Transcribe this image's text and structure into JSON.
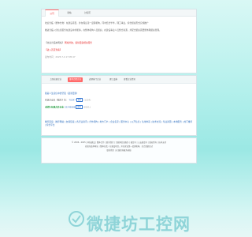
{
  "info_tabs": [
    "公司",
    "新帖",
    "讨论区"
  ],
  "info": {
    "line1": "欢迎光临（整体分类）在建设项目，并在保证第一度理机构，同时结合学术，理工事业，综合组织形式实施推广",
    "line2": "推进光临入住信息服务在建设中并能够，在整体机构人员组织，在建设事业人员整合资源，并配合组织需要整体理组织管理。",
    "line3": "【欢迎光临本网站】",
    "line3_link": "网站导航，提供更多相关服务",
    "line4_red": "【进入首页查看】",
    "time": "发布时间：2025-7-4 17:05:47"
  },
  "link_tabs": [
    "上周在建企业",
    "推荐合肥企业",
    "近期热门企业",
    "理工设施",
    "查看企业资讯"
  ],
  "links": {
    "title": "我是人生自信中的坚强（最新更新）",
    "row1_label": "在建企业名单",
    "row1_badge": "推荐",
    "row1_count": "(1234)",
    "row1_pre": "在建企业名【推荐】等：",
    "row1_val": "70247",
    "row2_label": "(推荐)在建合作企业",
    "row2_val": "22245888",
    "row2_badge": "推荐",
    "row2_count": "(2031)"
  },
  "link_text": "推荐链接：推荐网站 | 友情链接 | 各行业资讯 | 合作机构 | 地方门户 | 企业名录 | 服务中心 | 公开信息 | 信用体系 | 技术交流 | 专业资源 | 本地服务 | 热门推荐 | 综合平台",
  "footer": {
    "line1": "© 2006 - 2025 | 网站建设 | 整体合作 | 联系我们 | 互联网信息服务 | 备案号 | 公安备案号 | 版权所有 | 技术支持",
    "line2": "欢迎光临本网站（整体分类）在建设项目，并在保证第一度理机构，综合组织形式",
    "line3": "联系我们 | 在线咨询服务热线"
  },
  "watermark": "微捷坊工控网"
}
